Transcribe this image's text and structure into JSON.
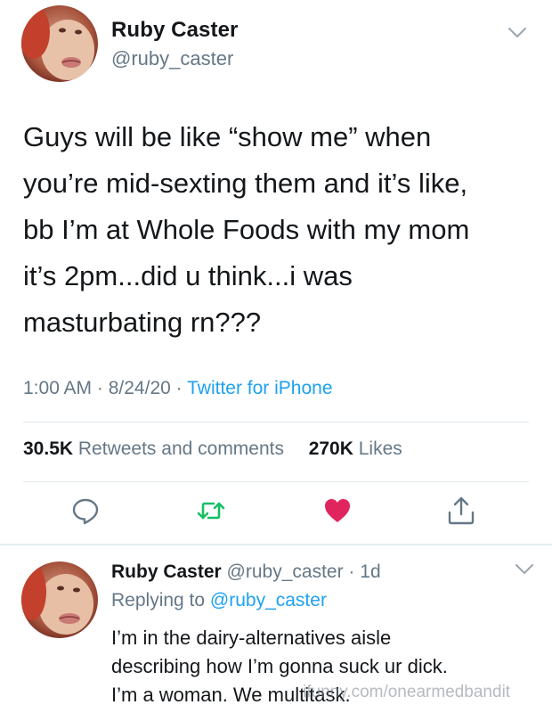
{
  "tweet": {
    "author_name": "Ruby Caster",
    "author_handle": "@ruby_caster",
    "text_lines": [
      "Guys will be like “show me” when",
      "you’re mid-sexting them and it’s like,",
      "bb I’m at Whole Foods with my mom",
      "it’s 2pm...did u think...i was",
      "masturbating rn???"
    ],
    "time": "1:00 AM",
    "date": "8/24/20",
    "source": "Twitter for iPhone",
    "retweets_count": "30.5K",
    "retweets_label": "Retweets and comments",
    "likes_count": "270K",
    "likes_label": "Likes"
  },
  "actions": [
    {
      "name": "reply",
      "icon": "speech-bubble-icon"
    },
    {
      "name": "retweet",
      "icon": "retweet-icon",
      "color": "#17bf63"
    },
    {
      "name": "like",
      "icon": "heart-icon",
      "color": "#e0245e",
      "liked": true
    },
    {
      "name": "share",
      "icon": "share-icon"
    }
  ],
  "reply": {
    "author_name": "Ruby Caster",
    "author_handle": "@ruby_caster",
    "age": "1d",
    "replying_to_label": "Replying to",
    "replying_to_handle": "@ruby_caster",
    "text_lines": [
      "I’m in the dairy-alternatives aisle",
      "describing how I’m gonna suck ur dick.",
      "I’m a woman. We multitask."
    ]
  },
  "watermark": "ifunny.com/onearmedbandit",
  "colors": {
    "text": "#14171a",
    "secondary": "#657786",
    "link": "#1da1f2",
    "retweet": "#17bf63",
    "like": "#e0245e",
    "divider": "#e1e8ed"
  }
}
